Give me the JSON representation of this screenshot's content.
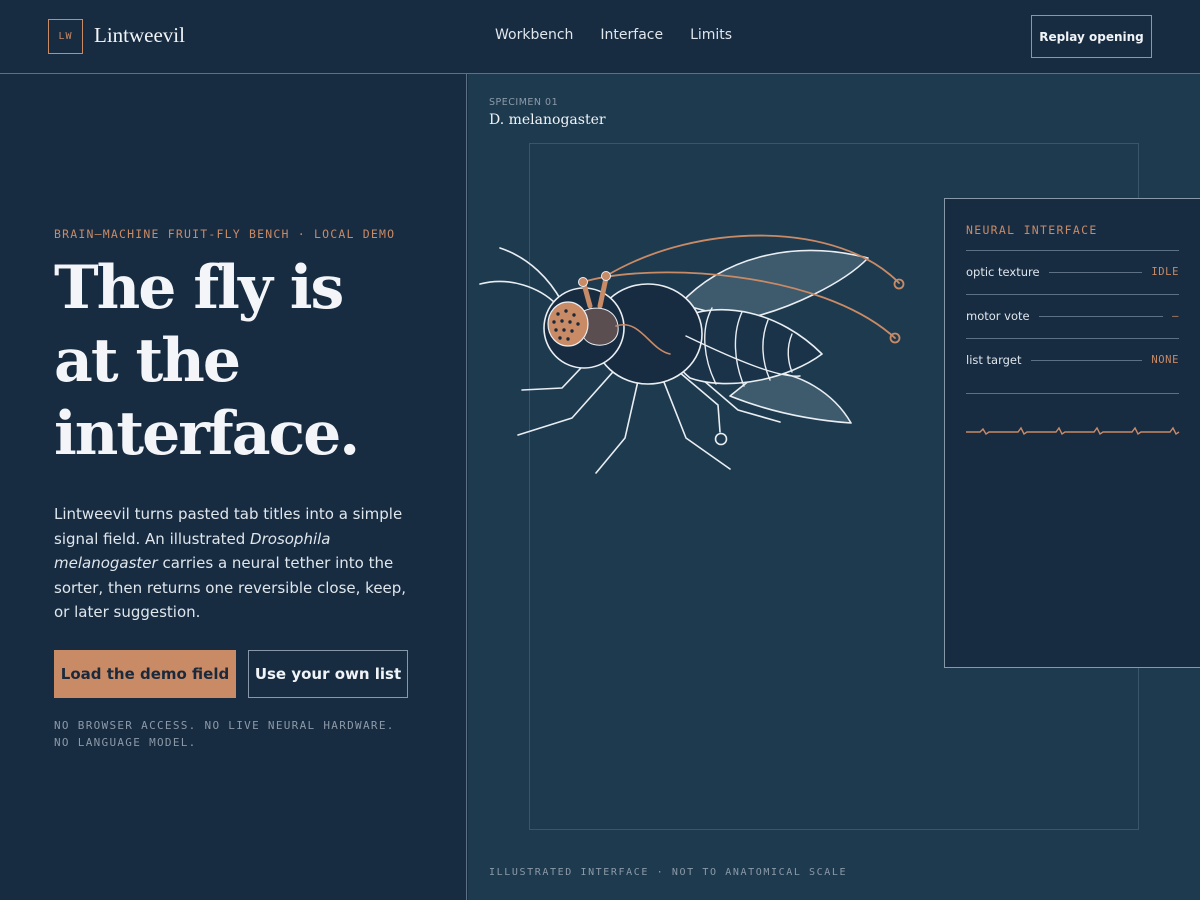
{
  "brand": {
    "mark": "LW",
    "name": "Lintweevil"
  },
  "nav": {
    "items": [
      "Workbench",
      "Interface",
      "Limits"
    ]
  },
  "header": {
    "replay_label": "Replay opening"
  },
  "hero": {
    "eyebrow": "BRAIN–MACHINE FRUIT-FLY BENCH · LOCAL DEMO",
    "headline_lines": [
      "The fly is",
      "at the",
      "interface."
    ],
    "lede": {
      "part1": "Lintweevil turns pasted tab titles into a simple signal field. An illustrated ",
      "species": "Drosophila melanogaster",
      "part2": " carries a neural tether into the sorter, then returns one reversible close, keep, or later suggestion."
    },
    "primary_button": "Load the demo field",
    "secondary_button": "Use your own list",
    "footnote_lines": [
      "NO BROWSER ACCESS. NO LIVE NEURAL HARDWARE.",
      "NO LANGUAGE MODEL."
    ]
  },
  "specimen": {
    "label": "SPECIMEN 01",
    "name": "D. melanogaster",
    "caption": "ILLUSTRATED INTERFACE · NOT TO ANATOMICAL SCALE"
  },
  "neural_panel": {
    "title": "NEURAL INTERFACE",
    "rows": [
      {
        "label": "optic texture",
        "value": "IDLE"
      },
      {
        "label": "motor vote",
        "value": "—"
      },
      {
        "label": "list target",
        "value": "NONE"
      }
    ]
  },
  "colors": {
    "background": "#172b41",
    "panel_background": "#1e3a4f",
    "accent": "#c98a66",
    "text": "#f1f4f7",
    "muted": "#8c9aa8"
  }
}
